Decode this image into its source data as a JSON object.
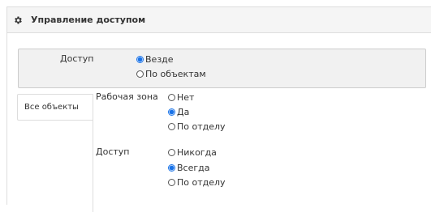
{
  "panel": {
    "title": "Управление доступом",
    "icon": "gear-icon"
  },
  "access_scope": {
    "label": "Доступ",
    "options": [
      "Везде",
      "По объектам"
    ],
    "selected": "Везде"
  },
  "tabs": [
    {
      "label": "Все объекты",
      "active": true
    }
  ],
  "workspace": {
    "label": "Рабочая зона",
    "options": [
      "Нет",
      "Да",
      "По отделу"
    ],
    "selected": "Да"
  },
  "access": {
    "label": "Доступ",
    "options": [
      "Никогда",
      "Всегда",
      "По отделу"
    ],
    "selected": "Всегда"
  },
  "colors": {
    "radio_selected": "#1a73e8",
    "header_bg": "#f5f5f5",
    "box_bg": "#f1f1f1"
  }
}
